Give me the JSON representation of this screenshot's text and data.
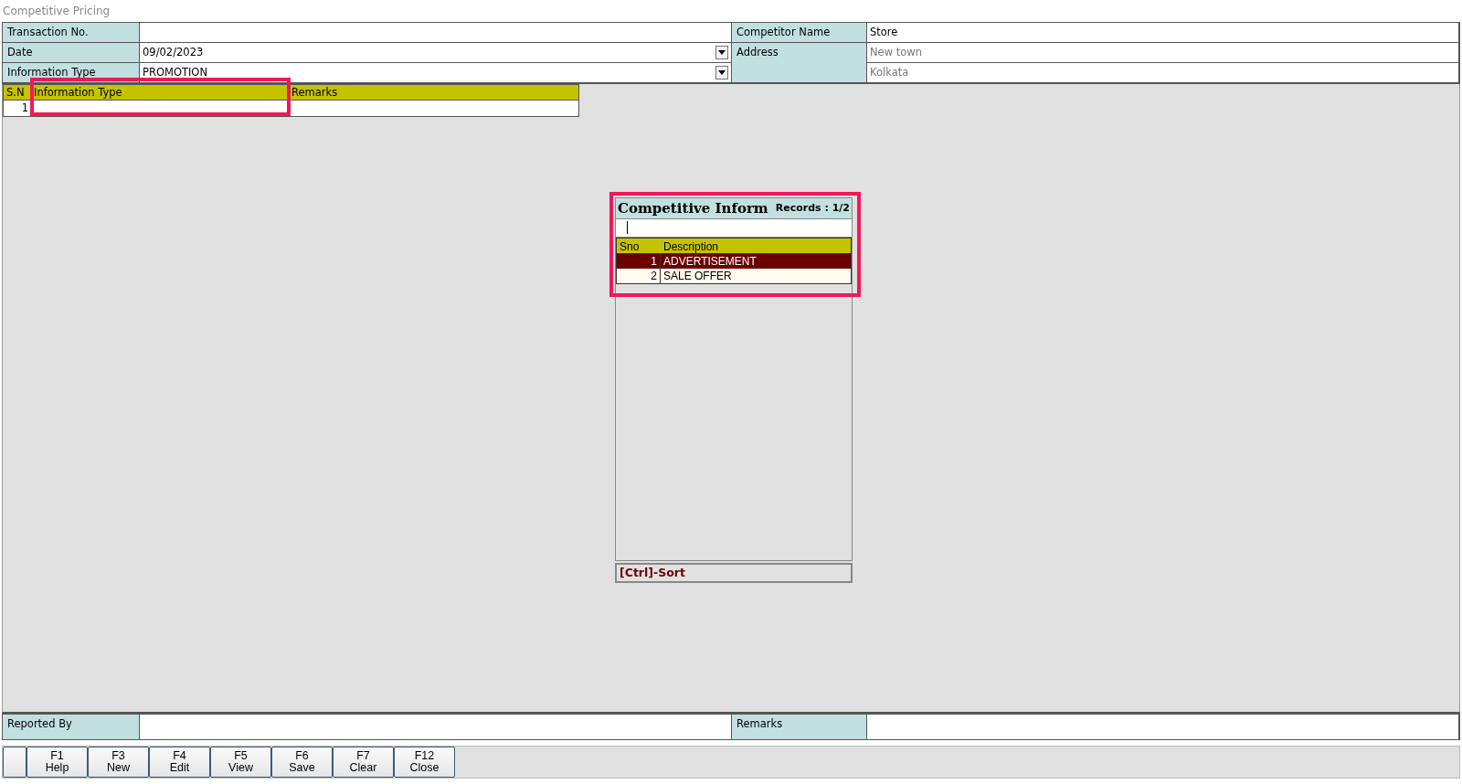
{
  "window": {
    "title": "Competitive Pricing"
  },
  "form_left": [
    {
      "label": "Transaction No.",
      "kind": "text"
    },
    {
      "label": "Date",
      "value": "09/02/2023",
      "kind": "dropdown"
    },
    {
      "label": "Information Type",
      "value": "PROMOTION",
      "kind": "dropdown"
    }
  ],
  "form_right": {
    "competitor_label": "Competitor Name",
    "competitor_value": "Store",
    "address_label": "Address",
    "address_lines": [
      "New town",
      "Kolkata"
    ]
  },
  "grid": {
    "columns": [
      "S.N",
      "Information Type",
      "Remarks"
    ],
    "rows": [
      {
        "sno": "1"
      }
    ],
    "highlighted": true
  },
  "popup": {
    "title": "Competitive Inform",
    "records": "Records : 1/2",
    "columns": [
      "Sno",
      "Description"
    ],
    "rows": [
      {
        "sno": "1",
        "description": "ADVERTISEMENT",
        "selected": true
      },
      {
        "sno": "2",
        "description": "SALE OFFER",
        "selected": false
      }
    ],
    "footer": "[Ctrl]-Sort",
    "highlighted": true
  },
  "footer_fields": [
    {
      "label": "Reported By"
    },
    {
      "label": "Remarks"
    }
  ],
  "buttons": [
    {
      "kind": "blank"
    },
    {
      "key": "F1",
      "label": "Help"
    },
    {
      "key": "F3",
      "label": "New"
    },
    {
      "key": "F4",
      "label": "Edit"
    },
    {
      "key": "F5",
      "label": "View"
    },
    {
      "key": "F6",
      "label": "Save"
    },
    {
      "key": "F7",
      "label": "Clear"
    },
    {
      "key": "F12",
      "label": "Close"
    }
  ]
}
